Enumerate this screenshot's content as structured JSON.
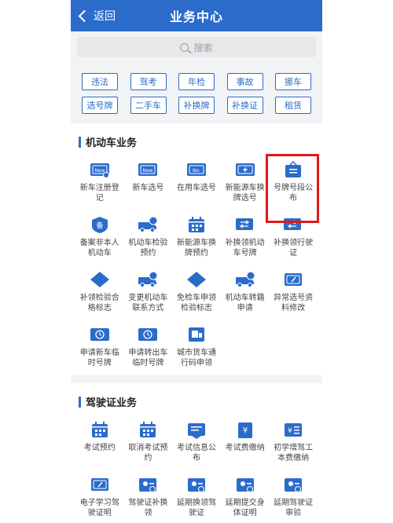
{
  "header": {
    "back_label": "返回",
    "title": "业务中心"
  },
  "search": {
    "placeholder": "搜索"
  },
  "chips_row1": [
    "违法",
    "驾考",
    "年检",
    "事故",
    "挪车"
  ],
  "chips_row2": [
    "选号牌",
    "二手车",
    "补换牌",
    "补换证",
    "租赁"
  ],
  "vehicle": {
    "title": "机动车业务",
    "items": [
      {
        "label": "新车注册登记",
        "icon": "new-card-icon"
      },
      {
        "label": "新车选号",
        "icon": "new-plate-icon"
      },
      {
        "label": "在用车选号",
        "icon": "no-plate-icon"
      },
      {
        "label": "新能源车换牌选号",
        "icon": "ev-plate-icon"
      },
      {
        "label": "号牌号段公布",
        "icon": "bulletin-icon"
      },
      {
        "label": "备案非本人机动车",
        "icon": "record-icon"
      },
      {
        "label": "机动车检验预约",
        "icon": "inspection-truck-icon"
      },
      {
        "label": "新能源车换牌预约",
        "icon": "ev-calendar-icon"
      },
      {
        "label": "补换领机动车号牌",
        "icon": "swap-plate-icon"
      },
      {
        "label": "补换领行驶证",
        "icon": "swap-license-icon"
      },
      {
        "label": "补领检验合格标志",
        "icon": "inspection-badge-icon"
      },
      {
        "label": "变更机动车联系方式",
        "icon": "phone-truck-icon"
      },
      {
        "label": "免检车申领检验标志",
        "icon": "exempt-badge-icon"
      },
      {
        "label": "机动车转籍申请",
        "icon": "transfer-truck-icon"
      },
      {
        "label": "异常选号资料修改",
        "icon": "edit-card-icon"
      },
      {
        "label": "申请新车临时号牌",
        "icon": "temp-plate-icon"
      },
      {
        "label": "申请转出车临时号牌",
        "icon": "temp-plate-out-icon"
      },
      {
        "label": "城市货车通行码申领",
        "icon": "freight-icon"
      }
    ]
  },
  "driver": {
    "title": "驾驶证业务",
    "items": [
      {
        "label": "考试预约",
        "icon": "calendar-icon"
      },
      {
        "label": "取消考试预约",
        "icon": "calendar-cancel-icon"
      },
      {
        "label": "考试信息公布",
        "icon": "info-board-icon"
      },
      {
        "label": "考试费缴纳",
        "icon": "fee-icon"
      },
      {
        "label": "初学增驾工本费缴纳",
        "icon": "fee-list-icon"
      },
      {
        "label": "电子学习驾驶证明",
        "icon": "e-doc-icon"
      },
      {
        "label": "驾驶证补换领",
        "icon": "license-swap-icon"
      },
      {
        "label": "延期换领驾驶证",
        "icon": "delay-swap-icon"
      },
      {
        "label": "延期提交身体证明",
        "icon": "delay-body-icon"
      },
      {
        "label": "延期驾驶证审验",
        "icon": "delay-review-icon"
      }
    ]
  },
  "colors": {
    "brand": "#2b6ccb",
    "highlight": "#e01919"
  }
}
